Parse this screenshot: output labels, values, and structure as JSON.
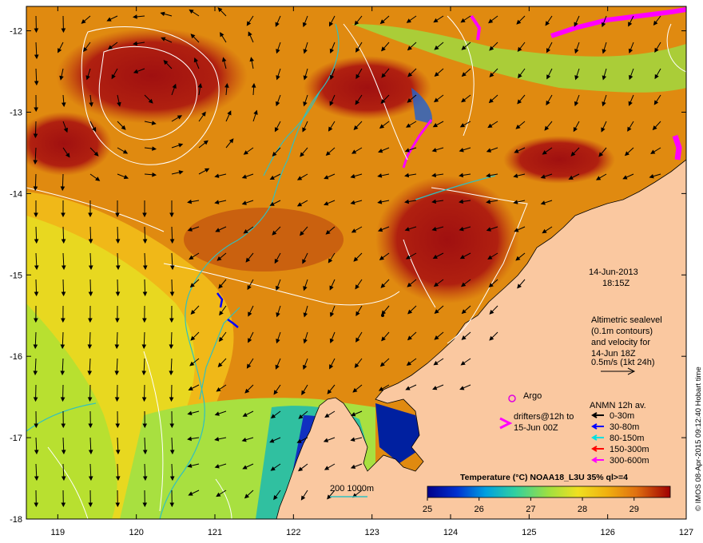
{
  "map": {
    "lon_ticks": [
      "119",
      "120",
      "121",
      "122",
      "123",
      "124",
      "125",
      "126",
      "127"
    ],
    "lat_ticks": [
      "-12",
      "-13",
      "-14",
      "-15",
      "-16",
      "-17",
      "-18"
    ],
    "lon_range": [
      118.6,
      127.0
    ],
    "lat_range": [
      -18.0,
      -11.7
    ]
  },
  "annotations": {
    "date": "14-Jun-2013",
    "time": "18:15Z",
    "altimetry_line1": "Altimetric sealevel",
    "altimetry_line2": "(0.1m contours)",
    "altimetry_line3": "and velocity for",
    "altimetry_line4": "14-Jun 18Z",
    "altimetry_line5": "0.5m/s (1kt 24h)",
    "bathy_label": "200  1000m"
  },
  "legend": {
    "argo_label": "Argo",
    "drifters_line1": "drifters@12h to",
    "drifters_line2": "15-Jun 00Z",
    "anmn_title": "ANMN 12h av.",
    "anmn_items": [
      {
        "label": "0-30m",
        "color": "#000000"
      },
      {
        "label": "30-80m",
        "color": "#0000ff"
      },
      {
        "label": "80-150m",
        "color": "#00e0e0"
      },
      {
        "label": "150-300m",
        "color": "#ff0000"
      },
      {
        "label": "300-600m",
        "color": "#ff00ff"
      }
    ]
  },
  "colorbar": {
    "title": "Temperature (°C) NOAA18_L3U 35% ql>=4",
    "ticks": [
      "25",
      "26",
      "27",
      "28",
      "29"
    ],
    "range": [
      25,
      29.7
    ]
  },
  "credit": "© IMOS 08-Apr-2015 09:12:40 Hobart time",
  "colors": {
    "land": "#fac8a0",
    "warm": "#e08a10",
    "hot": "#a01010",
    "mid": "#f0c020",
    "cool": "#c8e030",
    "cold": "#0000a0",
    "argo": "#e000e0",
    "bathy": "#30c0c0"
  }
}
